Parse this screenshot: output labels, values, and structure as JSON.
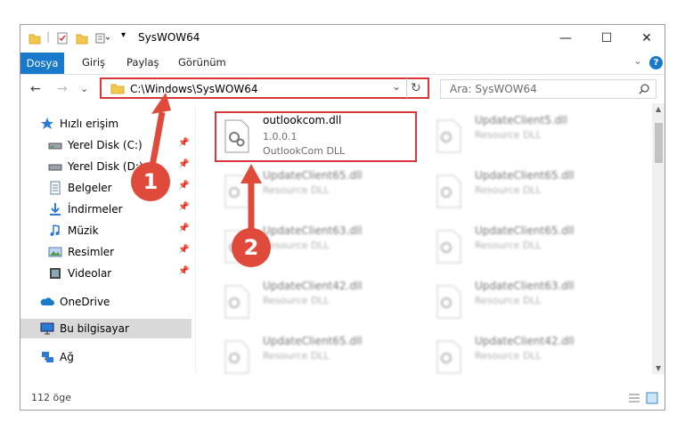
{
  "window": {
    "title": "SysWOW64"
  },
  "titlebar": {
    "minimize": "—",
    "maximize": "☐",
    "close": "✕"
  },
  "ribbon": {
    "tabs": [
      "Dosya",
      "Giriş",
      "Paylaş",
      "Görünüm"
    ],
    "expand": "⌄",
    "help": "?"
  },
  "nav": {
    "back": "←",
    "forward": "→",
    "recent": "⌄",
    "up": "↑",
    "dropdown": "⌄",
    "refresh": "↻"
  },
  "address": {
    "path": "C:\\Windows\\SysWOW64"
  },
  "search": {
    "placeholder": "Ara: SysWOW64"
  },
  "sidebar": {
    "items": [
      {
        "label": "Hızlı erişim",
        "icon": "star-icon"
      },
      {
        "label": "Yerel Disk (C:)",
        "icon": "drive-icon"
      },
      {
        "label": "Yerel Disk (D:)",
        "icon": "drive-icon"
      },
      {
        "label": "Belgeler",
        "icon": "documents-icon"
      },
      {
        "label": "İndirmeler",
        "icon": "download-icon"
      },
      {
        "label": "Müzik",
        "icon": "music-icon"
      },
      {
        "label": "Resimler",
        "icon": "pictures-icon"
      },
      {
        "label": "Videolar",
        "icon": "video-icon"
      },
      {
        "label": "OneDrive",
        "icon": "cloud-icon"
      },
      {
        "label": "Bu bilgisayar",
        "icon": "computer-icon"
      },
      {
        "label": "Ağ",
        "icon": "network-icon"
      }
    ]
  },
  "files": {
    "focused": {
      "name": "outlookcom.dll",
      "version": "1.0.0.1",
      "desc": "OutlookCom DLL"
    },
    "others": [
      {
        "name": "UpdateClient5.dll",
        "desc": "Resource DLL"
      },
      {
        "name": "UpdateClient65.dll",
        "desc": "Resource DLL"
      },
      {
        "name": "UpdateClient65.dll",
        "desc": "Resource DLL"
      },
      {
        "name": "UpdateClient63.dll",
        "desc": "Resource DLL"
      },
      {
        "name": "UpdateClient65.dll",
        "desc": "Resource DLL"
      },
      {
        "name": "UpdateClient42.dll",
        "desc": "Resource DLL"
      },
      {
        "name": "UpdateClient63.dll",
        "desc": "Resource DLL"
      },
      {
        "name": "UpdateClient65.dll",
        "desc": "Resource DLL"
      },
      {
        "name": "UpdateClient42.dll",
        "desc": "Resource DLL"
      }
    ]
  },
  "status": {
    "count": "112 öge"
  },
  "annotations": {
    "step1": "1",
    "step2": "2"
  },
  "colors": {
    "accent": "#1979ca",
    "highlight": "#d9383a",
    "badge": "#e04a3a"
  }
}
